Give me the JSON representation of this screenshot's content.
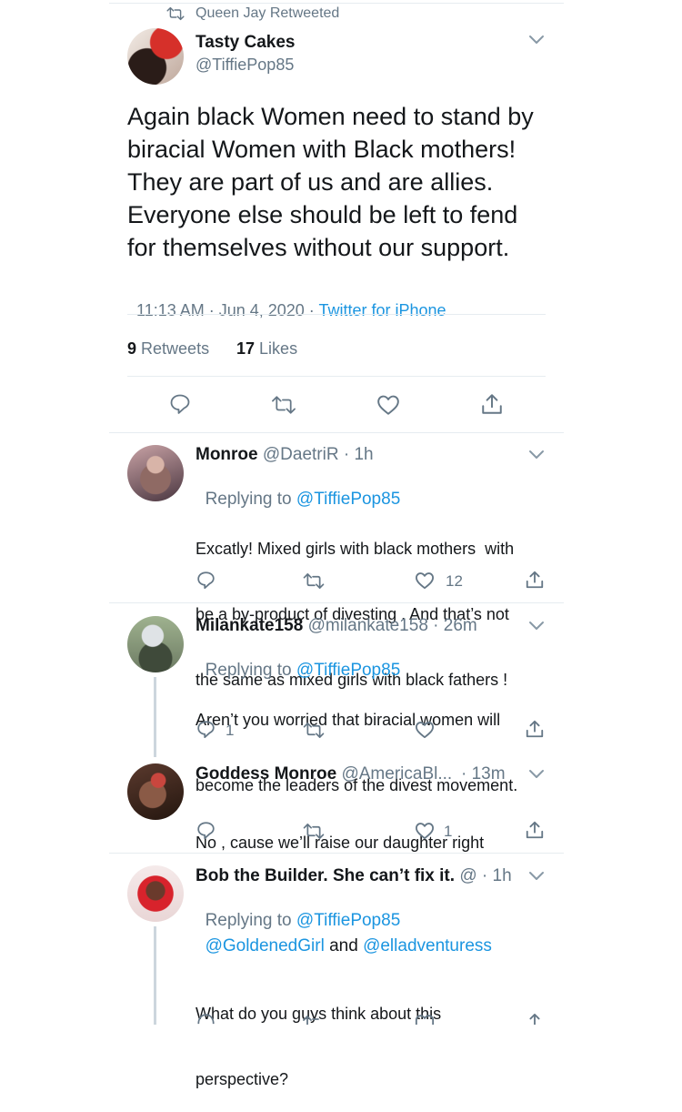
{
  "main_tweet": {
    "retweeted_by": "Queen Jay Retweeted",
    "author_name": "Tasty Cakes",
    "author_handle": "@TiffiePop85",
    "text_lines": [
      "Again black Women need to stand by",
      "biracial Women with Black mothers!",
      "They are part of us and are allies.",
      "Everyone else should be left to fend",
      "for themselves without our support."
    ],
    "time": "11:13 AM · Jun 4, 2020 · ",
    "source": "Twitter for iPhone",
    "retweets_count": "9",
    "retweets_label": "Retweets",
    "likes_count": "17",
    "likes_label": "Likes"
  },
  "replies": [
    {
      "name": "Monroe",
      "handle": "@DaetriR · 1h",
      "replying_label": "Replying to ",
      "replying_to": "@TiffiePop85",
      "text_lines": [
        "Excatly! Mixed girls with black mothers  with",
        "be a by-product of divesting . And that’s not",
        "the same as mixed girls with black fathers !"
      ],
      "reply_count": "",
      "like_count": "12"
    },
    {
      "name": "Milankate158",
      "handle": "@milankate158 · 26m",
      "replying_label": "Replying to ",
      "replying_to": "@TiffiePop85",
      "text_lines": [
        "Aren’t you worried that biracial women will",
        "become the leaders of the divest movement."
      ],
      "reply_count": "1",
      "like_count": ""
    },
    {
      "name": "Goddess Monroe",
      "handle": "@AmericaBl...",
      "time": "· 13m",
      "text_lines": [
        "No , cause we’ll raise our daughter right"
      ],
      "reply_count": "",
      "like_count": "1"
    },
    {
      "name": "Bob the Builder. She can’t fix it.",
      "handle_glyph": "@",
      "time": "· 1h",
      "replying_label": "Replying to ",
      "replying_to": "@TiffiePop85",
      "mention_1": "@GoldenedGirl",
      "mention_and": " and ",
      "mention_2": "@elladventuress",
      "text_lines": [
        "What do you guys think about this",
        "perspective?"
      ]
    }
  ],
  "icons": {
    "retweet": "retweet-icon",
    "chevron": "chevron-down-icon",
    "reply": "reply-icon",
    "like": "heart-icon",
    "share": "share-icon"
  },
  "colors": {
    "link": "#1b95e0",
    "secondary": "#657786",
    "divider": "#e6ecf0",
    "thread": "#ccd6dd"
  }
}
